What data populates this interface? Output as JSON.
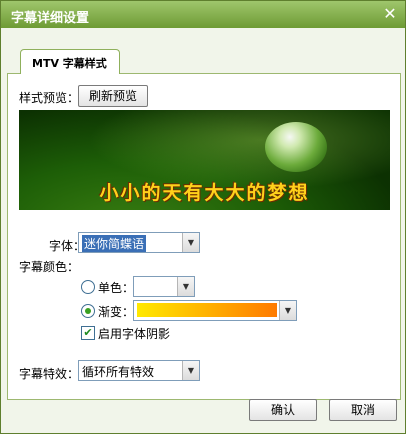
{
  "window": {
    "title": "字幕详细设置",
    "close_icon": "close-icon"
  },
  "tab": {
    "label": "MTV 字幕样式"
  },
  "style_preview": {
    "label": "样式预览：",
    "refresh_button": "刷新预览",
    "preview_text": "小小的天有大大的梦想"
  },
  "font": {
    "label": "字体：",
    "value": "迷你简蝶语"
  },
  "color": {
    "label": "字幕颜色：",
    "single_label": "单色：",
    "gradient_label": "渐变：",
    "gradient_colors": [
      "#ffe900",
      "#ff7a00"
    ],
    "shadow_label": "启用字体阴影",
    "selected": "gradient",
    "shadow_enabled": true
  },
  "effect": {
    "label": "字幕特效：",
    "value": "循环所有特效"
  },
  "footer": {
    "ok_button": "确认",
    "cancel_button": "取消"
  },
  "colors": {
    "title_bar": "#7aa63e",
    "panel_border": "#9db870",
    "accent_green": "#39a020"
  }
}
